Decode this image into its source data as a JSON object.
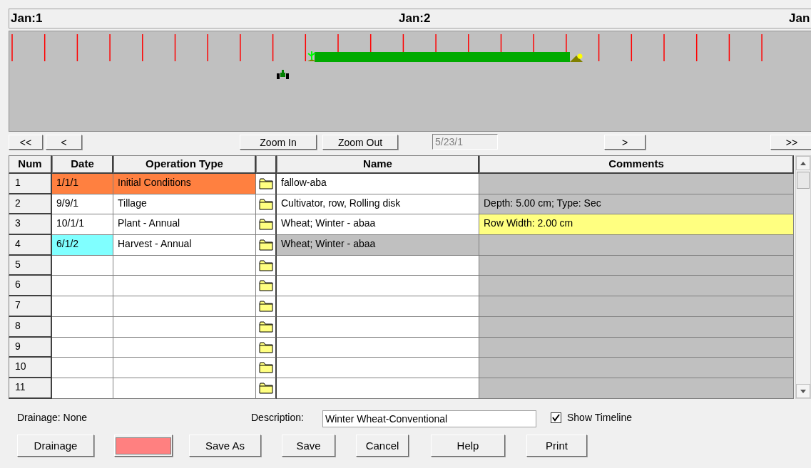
{
  "timeline": {
    "scale_labels": [
      "Jan:1",
      "Jan:2",
      "Jan"
    ]
  },
  "navigation": {
    "buttons": [
      "<<",
      "<",
      "Zoom In",
      "Zoom Out",
      ">",
      ">>"
    ],
    "date_field": {
      "value": "5/23/1",
      "disabled": true
    }
  },
  "table": {
    "columns": [
      "Num",
      "Date",
      "Operation Type",
      "",
      "Name",
      "Comments"
    ],
    "rows": [
      {
        "num": "1",
        "date": {
          "text": "1/1/1",
          "color": "#ff8040"
        },
        "operation_type": {
          "text": "Initial Conditions",
          "color": "#ff8040"
        },
        "name": {
          "text": "fallow-aba",
          "color": "#ffffff"
        },
        "comments": {
          "color": "#c0c0c0"
        }
      },
      {
        "num": "2",
        "date": {
          "text": "9/9/1",
          "color": "#ffffff"
        },
        "operation_type": {
          "text": "Tillage",
          "color": "#ffffff"
        },
        "name": {
          "text": "Cultivator, row, Rolling disk",
          "color": "#ffffff"
        },
        "comments": {
          "text": "Depth: 5.00 cm; Type: Sec",
          "color": "#c0c0c0"
        }
      },
      {
        "num": "3",
        "date": {
          "text": "10/1/1",
          "color": "#ffffff"
        },
        "operation_type": {
          "text": "Plant - Annual",
          "color": "#ffffff"
        },
        "name": {
          "text": "Wheat; Winter - abaa",
          "color": "#ffffff"
        },
        "comments": {
          "text": "Row Width: 2.00 cm",
          "color": "#ffff80"
        }
      },
      {
        "num": "4",
        "date": {
          "text": "6/1/2",
          "color": "#80ffff"
        },
        "operation_type": {
          "text": "Harvest - Annual",
          "color": "#ffffff"
        },
        "name": {
          "text": "Wheat; Winter - abaa",
          "color": "#c0c0c0"
        },
        "comments": {
          "color": "#c0c0c0"
        }
      },
      {
        "num": "5"
      },
      {
        "num": "6"
      },
      {
        "num": "7"
      },
      {
        "num": "8"
      },
      {
        "num": "9"
      },
      {
        "num": "10"
      },
      {
        "num": "11"
      }
    ]
  },
  "footer": {
    "drainage": "Drainage: None",
    "description_label": "Description:",
    "description": "Winter Wheat-Conventional",
    "show_timeline": {
      "label": "Show Timeline",
      "checked": true
    },
    "buttons": [
      {
        "kind": "text",
        "label": "Drainage"
      },
      {
        "kind": "swatch",
        "color": "#ff8080"
      },
      {
        "kind": "text",
        "label": "Save As"
      },
      {
        "kind": "text",
        "label": "Save"
      },
      {
        "kind": "text",
        "label": "Cancel"
      },
      {
        "kind": "text",
        "label": "Help"
      },
      {
        "kind": "text",
        "label": "Print"
      }
    ]
  }
}
